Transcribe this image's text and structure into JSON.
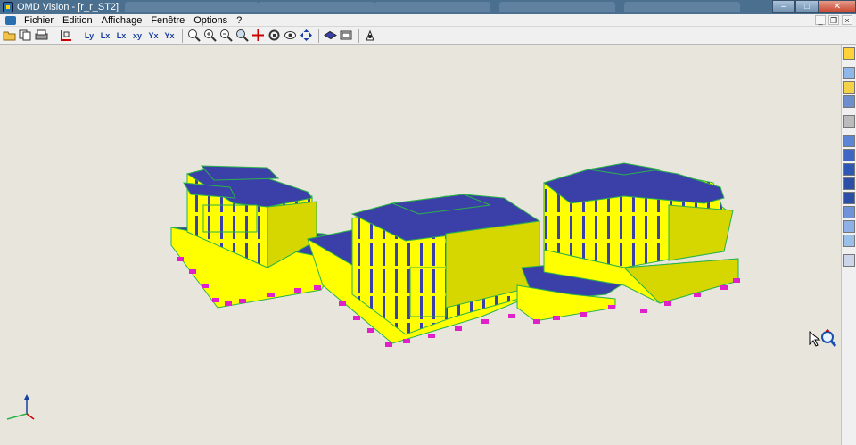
{
  "window": {
    "title": "OMD Vision - [r_r_ST2]"
  },
  "menu": {
    "items": [
      "Fichier",
      "Edition",
      "Affichage",
      "Fenêtre",
      "Options",
      "?"
    ]
  },
  "window_controls": {
    "minimize": "–",
    "maximize": "□",
    "close": "✕"
  },
  "mdi_controls": {
    "minimize": "_",
    "restore": "❐",
    "close": "×"
  },
  "toolbar": {
    "axis_buttons": [
      "Ly",
      "Lx",
      "Lx",
      "xy",
      "Yx",
      "Yx"
    ]
  },
  "icons": {
    "toolbar": [
      "open-folder-icon",
      "copy-icon",
      "print-icon",
      "axes-icon",
      "view-ly-icon",
      "view-lx-icon",
      "view-lx2-icon",
      "view-xy-icon",
      "view-yx-icon",
      "view-yx2-icon",
      "zoom-window-icon",
      "zoom-in-icon",
      "zoom-out-icon",
      "zoom-extents-icon",
      "pan-icon",
      "rotate-icon",
      "orbit-icon",
      "move-icon",
      "section-icon",
      "display-icon",
      "render-icon"
    ],
    "sidebar": [
      "query-icon",
      "layers-icon",
      "color-icon",
      "columns-icon",
      "mesh-icon",
      "beam-icon",
      "slab-icon",
      "wall-icon",
      "column-icon",
      "pillar-icon",
      "edit-icon",
      "line-icon",
      "photo-icon",
      "delete-icon"
    ]
  },
  "colors": {
    "walls": "#ffff00",
    "walls_shade": "#d6d600",
    "slabs": "#3b3fa8",
    "edges": "#2ab24a",
    "footings": "#e020c8",
    "background": "#e8e6dc"
  }
}
